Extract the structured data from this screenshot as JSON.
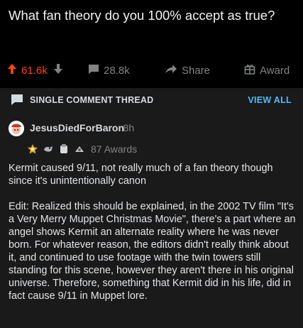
{
  "post": {
    "title": "What fan theory do you 100% accept as true?"
  },
  "actions": {
    "upvotes": "61.6k",
    "comments": "28.8k",
    "share_label": "Share",
    "award_label": "Award"
  },
  "thread_bar": {
    "label": "SINGLE COMMENT THREAD",
    "view_all": "VIEW ALL"
  },
  "comment": {
    "author": "JesusDiedForBaron",
    "age": "· 8h",
    "awards_count": "87 Awards",
    "paragraphs": [
      "Kermit caused 9/11, not really much of a fan theory though since it's unintentionally canon",
      "Edit: Realized this should be explained, in the 2002 TV film \"It's a Very Merry Muppet Christmas Movie\", there's a part where an angel shows Kermit an alternate reality where he was never born. For whatever reason, the editors didn't really think about it, and continued to use footage with the twin towers still standing for this scene, however they aren't there in his original universe. Therefore, something that Kermit did in his life, did in fact cause 9/11 in Muppet lore."
    ]
  },
  "colors": {
    "background": "#000000",
    "panel": "#1a1a1b",
    "upvote": "#ff4500",
    "link": "#4fbcff",
    "muted": "#818384"
  }
}
